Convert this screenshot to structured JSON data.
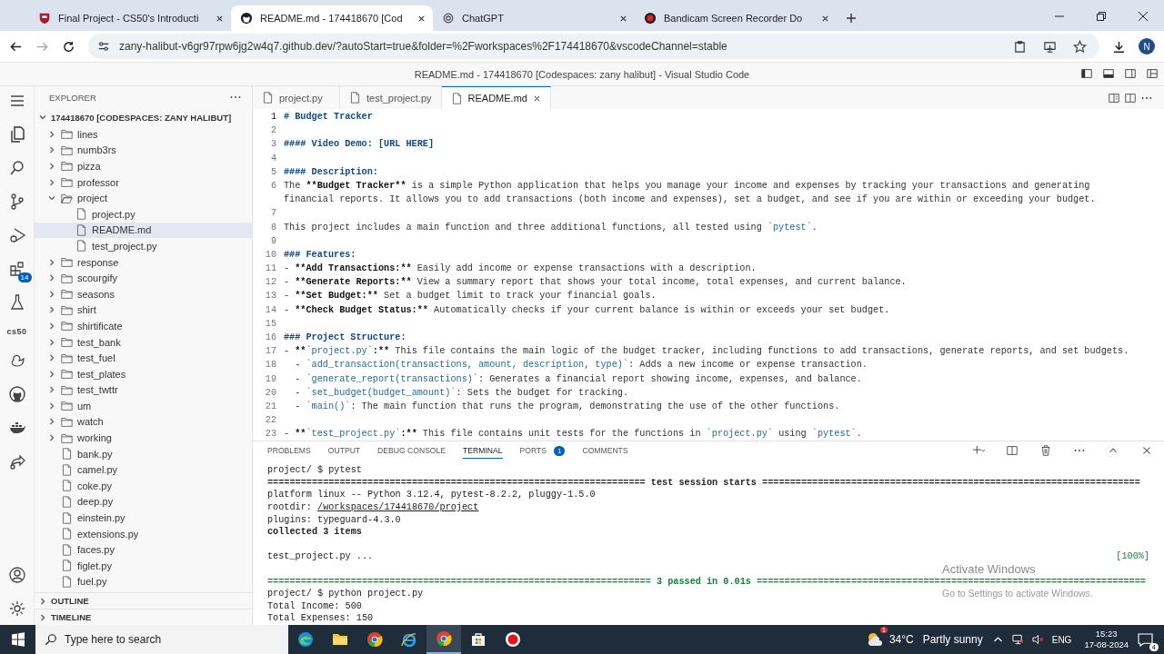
{
  "browser": {
    "tabs": [
      {
        "title": "Final Project - CS50's Introducti",
        "kind": "shield",
        "selected": false
      },
      {
        "title": "README.md - 174418670 [Cod",
        "kind": "github",
        "selected": true
      },
      {
        "title": "ChatGPT",
        "kind": "chatgpt",
        "selected": false
      },
      {
        "title": "Bandicam Screen Recorder Do",
        "kind": "record",
        "selected": false
      }
    ],
    "url": "zany-halibut-v6gr97rpw6jg2w4q7.github.dev/?autoStart=true&folder=%2Fworkspaces%2F174418670&vscodeChannel=stable",
    "profile": "N"
  },
  "window": {
    "title": "README.md - 174418670 [Codespaces: zany halibut] - Visual Studio Code"
  },
  "activity_bar": {
    "extensions_badge": "14",
    "cs50_label": "cs50"
  },
  "sidebar": {
    "title": "EXPLORER",
    "root": "174418670 [CODESPACES: ZANY HALIBUT]",
    "items": [
      {
        "label": "lines",
        "kind": "folder",
        "expanded": false,
        "selected": false
      },
      {
        "label": "numb3rs",
        "kind": "folder",
        "expanded": false,
        "selected": false
      },
      {
        "label": "pizza",
        "kind": "folder",
        "expanded": false,
        "selected": false
      },
      {
        "label": "professor",
        "kind": "folder",
        "expanded": false,
        "selected": false
      },
      {
        "label": "project",
        "kind": "folder",
        "expanded": true,
        "selected": false,
        "children": [
          {
            "label": "project.py",
            "kind": "file",
            "selected": false
          },
          {
            "label": "README.md",
            "kind": "file",
            "selected": true
          },
          {
            "label": "test_project.py",
            "kind": "file",
            "selected": false
          }
        ]
      },
      {
        "label": "response",
        "kind": "folder",
        "expanded": false,
        "selected": false
      },
      {
        "label": "scourgify",
        "kind": "folder",
        "expanded": false,
        "selected": false
      },
      {
        "label": "seasons",
        "kind": "folder",
        "expanded": false,
        "selected": false
      },
      {
        "label": "shirt",
        "kind": "folder",
        "expanded": false,
        "selected": false
      },
      {
        "label": "shirtificate",
        "kind": "folder",
        "expanded": false,
        "selected": false
      },
      {
        "label": "test_bank",
        "kind": "folder",
        "expanded": false,
        "selected": false
      },
      {
        "label": "test_fuel",
        "kind": "folder",
        "expanded": false,
        "selected": false
      },
      {
        "label": "test_plates",
        "kind": "folder",
        "expanded": false,
        "selected": false
      },
      {
        "label": "test_twttr",
        "kind": "folder",
        "expanded": false,
        "selected": false
      },
      {
        "label": "um",
        "kind": "folder",
        "expanded": false,
        "selected": false
      },
      {
        "label": "watch",
        "kind": "folder",
        "expanded": false,
        "selected": false
      },
      {
        "label": "working",
        "kind": "folder",
        "expanded": false,
        "selected": false
      },
      {
        "label": "bank.py",
        "kind": "file",
        "selected": false
      },
      {
        "label": "camel.py",
        "kind": "file",
        "selected": false
      },
      {
        "label": "coke.py",
        "kind": "file",
        "selected": false
      },
      {
        "label": "deep.py",
        "kind": "file",
        "selected": false
      },
      {
        "label": "einstein.py",
        "kind": "file",
        "selected": false
      },
      {
        "label": "extensions.py",
        "kind": "file",
        "selected": false
      },
      {
        "label": "faces.py",
        "kind": "file",
        "selected": false
      },
      {
        "label": "figlet.py",
        "kind": "file",
        "selected": false
      },
      {
        "label": "fuel.py",
        "kind": "file",
        "selected": false
      }
    ],
    "sections": [
      "OUTLINE",
      "TIMELINE"
    ]
  },
  "editor": {
    "tabs": [
      {
        "label": "project.py",
        "selected": false
      },
      {
        "label": "test_project.py",
        "selected": false
      },
      {
        "label": "README.md",
        "selected": true
      }
    ],
    "lines": [
      {
        "number": "1",
        "segments": [
          {
            "kind": "heading",
            "text": "# Budget Tracker"
          }
        ]
      },
      {
        "number": "2"
      },
      {
        "number": "3",
        "segments": [
          {
            "kind": "heading",
            "text": "#### Video Demo: [URL HERE]"
          }
        ]
      },
      {
        "number": "4"
      },
      {
        "number": "5",
        "segments": [
          {
            "kind": "heading",
            "text": "#### Description:"
          }
        ]
      },
      {
        "number": "6",
        "segments": [
          {
            "kind": "plain",
            "text": "The "
          },
          {
            "kind": "bold",
            "text": "**Budget Tracker**"
          },
          {
            "kind": "plain",
            "text": " is a simple Python application that helps you manage your income and expenses by tracking your transactions and generating"
          }
        ]
      },
      {
        "segments": [
          {
            "kind": "plain",
            "text": "financial reports. It allows you to add transactions (both income and expenses), set a budget, and see if you are within or exceeding your budget."
          }
        ]
      },
      {
        "number": "7"
      },
      {
        "number": "8",
        "segments": [
          {
            "kind": "plain",
            "text": "This project includes a main function and three additional functions, all tested using "
          },
          {
            "kind": "code",
            "text": "`pytest`"
          },
          {
            "kind": "plain",
            "text": "."
          }
        ]
      },
      {
        "number": "9"
      },
      {
        "number": "10",
        "segments": [
          {
            "kind": "heading",
            "text": "### Features:"
          }
        ]
      },
      {
        "number": "11",
        "segments": [
          {
            "kind": "plain",
            "text": "- "
          },
          {
            "kind": "bold",
            "text": "**Add Transactions:**"
          },
          {
            "kind": "plain",
            "text": " Easily add income or expense transactions with a description."
          }
        ]
      },
      {
        "number": "12",
        "segments": [
          {
            "kind": "plain",
            "text": "- "
          },
          {
            "kind": "bold",
            "text": "**Generate Reports:**"
          },
          {
            "kind": "plain",
            "text": " View a summary report that shows your total income, total expenses, and current balance."
          }
        ]
      },
      {
        "number": "13",
        "segments": [
          {
            "kind": "plain",
            "text": "- "
          },
          {
            "kind": "bold",
            "text": "**Set Budget:**"
          },
          {
            "kind": "plain",
            "text": " Set a budget limit to track your financial goals."
          }
        ]
      },
      {
        "number": "14",
        "segments": [
          {
            "kind": "plain",
            "text": "- "
          },
          {
            "kind": "bold",
            "text": "**Check Budget Status:**"
          },
          {
            "kind": "plain",
            "text": " Automatically checks if your current balance is within or exceeds your set budget."
          }
        ]
      },
      {
        "number": "15"
      },
      {
        "number": "16",
        "segments": [
          {
            "kind": "heading",
            "text": "### Project Structure:"
          }
        ]
      },
      {
        "number": "17",
        "segments": [
          {
            "kind": "plain",
            "text": "- "
          },
          {
            "kind": "bold",
            "text": "**"
          },
          {
            "kind": "code",
            "text": "`project.py`"
          },
          {
            "kind": "bold",
            "text": ":**"
          },
          {
            "kind": "plain",
            "text": " This file contains the main logic of the budget tracker, including functions to add transactions, generate reports, and set budgets."
          }
        ]
      },
      {
        "number": "18",
        "segments": [
          {
            "kind": "plain",
            "text": "  - "
          },
          {
            "kind": "code",
            "text": "`add_transaction(transactions, amount, description, type)`"
          },
          {
            "kind": "plain",
            "text": ": Adds a new income or expense transaction."
          }
        ]
      },
      {
        "number": "19",
        "segments": [
          {
            "kind": "plain",
            "text": "  - "
          },
          {
            "kind": "code",
            "text": "`generate_report(transactions)`"
          },
          {
            "kind": "plain",
            "text": ": Generates a financial report showing income, expenses, and balance."
          }
        ]
      },
      {
        "number": "20",
        "segments": [
          {
            "kind": "plain",
            "text": "  - "
          },
          {
            "kind": "code",
            "text": "`set_budget(budget_amount)`"
          },
          {
            "kind": "plain",
            "text": ": Sets the budget for tracking."
          }
        ]
      },
      {
        "number": "21",
        "segments": [
          {
            "kind": "plain",
            "text": "  - "
          },
          {
            "kind": "code",
            "text": "`main()`"
          },
          {
            "kind": "plain",
            "text": ": The main function that runs the program, demonstrating the use of the other functions."
          }
        ]
      },
      {
        "number": "22"
      },
      {
        "number": "23",
        "segments": [
          {
            "kind": "plain",
            "text": "- "
          },
          {
            "kind": "bold",
            "text": "**"
          },
          {
            "kind": "code",
            "text": "`test_project.py`"
          },
          {
            "kind": "bold",
            "text": ":**"
          },
          {
            "kind": "plain",
            "text": " This file contains unit tests for the functions in "
          },
          {
            "kind": "code",
            "text": "`project.py`"
          },
          {
            "kind": "plain",
            "text": " using "
          },
          {
            "kind": "code",
            "text": "`pytest`"
          },
          {
            "kind": "plain",
            "text": "."
          }
        ]
      }
    ]
  },
  "panel": {
    "tabs": [
      {
        "label": "PROBLEMS",
        "selected": false
      },
      {
        "label": "OUTPUT",
        "selected": false
      },
      {
        "label": "DEBUG CONSOLE",
        "selected": false
      },
      {
        "label": "TERMINAL",
        "selected": true
      },
      {
        "label": "PORTS",
        "selected": false,
        "badge": "1"
      },
      {
        "label": "COMMENTS",
        "selected": false
      }
    ],
    "terminal": [
      {
        "kind": "text",
        "text": "project/ $ pytest"
      },
      {
        "kind": "separator",
        "text": "==================================================================== test session starts ===================================================================="
      },
      {
        "kind": "text",
        "text": "platform linux -- Python 3.12.4, pytest-8.2.2, pluggy-1.5.0"
      },
      {
        "kind": "path",
        "text": "rootdir: ",
        "link": "/workspaces/174418670/project"
      },
      {
        "kind": "text",
        "text": "plugins: typeguard-4.3.0"
      },
      {
        "kind": "bold",
        "text": "collected 3 items"
      },
      {
        "kind": "blank"
      },
      {
        "kind": "progress",
        "text": "test_project.py ...",
        "right": "[100%]"
      },
      {
        "kind": "blank"
      },
      {
        "kind": "result",
        "text": "===================================================================== 3 passed in 0.01s ======================================================================"
      },
      {
        "kind": "text",
        "text": "project/ $ python project.py"
      },
      {
        "kind": "text",
        "text": "Total Income: 500"
      },
      {
        "kind": "text",
        "text": "Total Expenses: 150"
      }
    ]
  },
  "activation": {
    "title": "Activate Windows",
    "hint": "Go to Settings to activate Windows."
  },
  "taskbar": {
    "search_placeholder": "Type here to search",
    "apps": [
      {
        "kind": "edge",
        "selected": false
      },
      {
        "kind": "folder",
        "selected": false
      },
      {
        "kind": "chrome",
        "selected": false
      },
      {
        "kind": "ie",
        "selected": false
      },
      {
        "kind": "chrome",
        "selected": true
      },
      {
        "kind": "store",
        "selected": false
      },
      {
        "kind": "record",
        "selected": false
      }
    ],
    "weather_badge": "1",
    "weather": "34°C",
    "forecast": "Partly sunny",
    "language": "ENG",
    "time": "15:23",
    "date": "17-08-2024",
    "notifications": "4"
  }
}
